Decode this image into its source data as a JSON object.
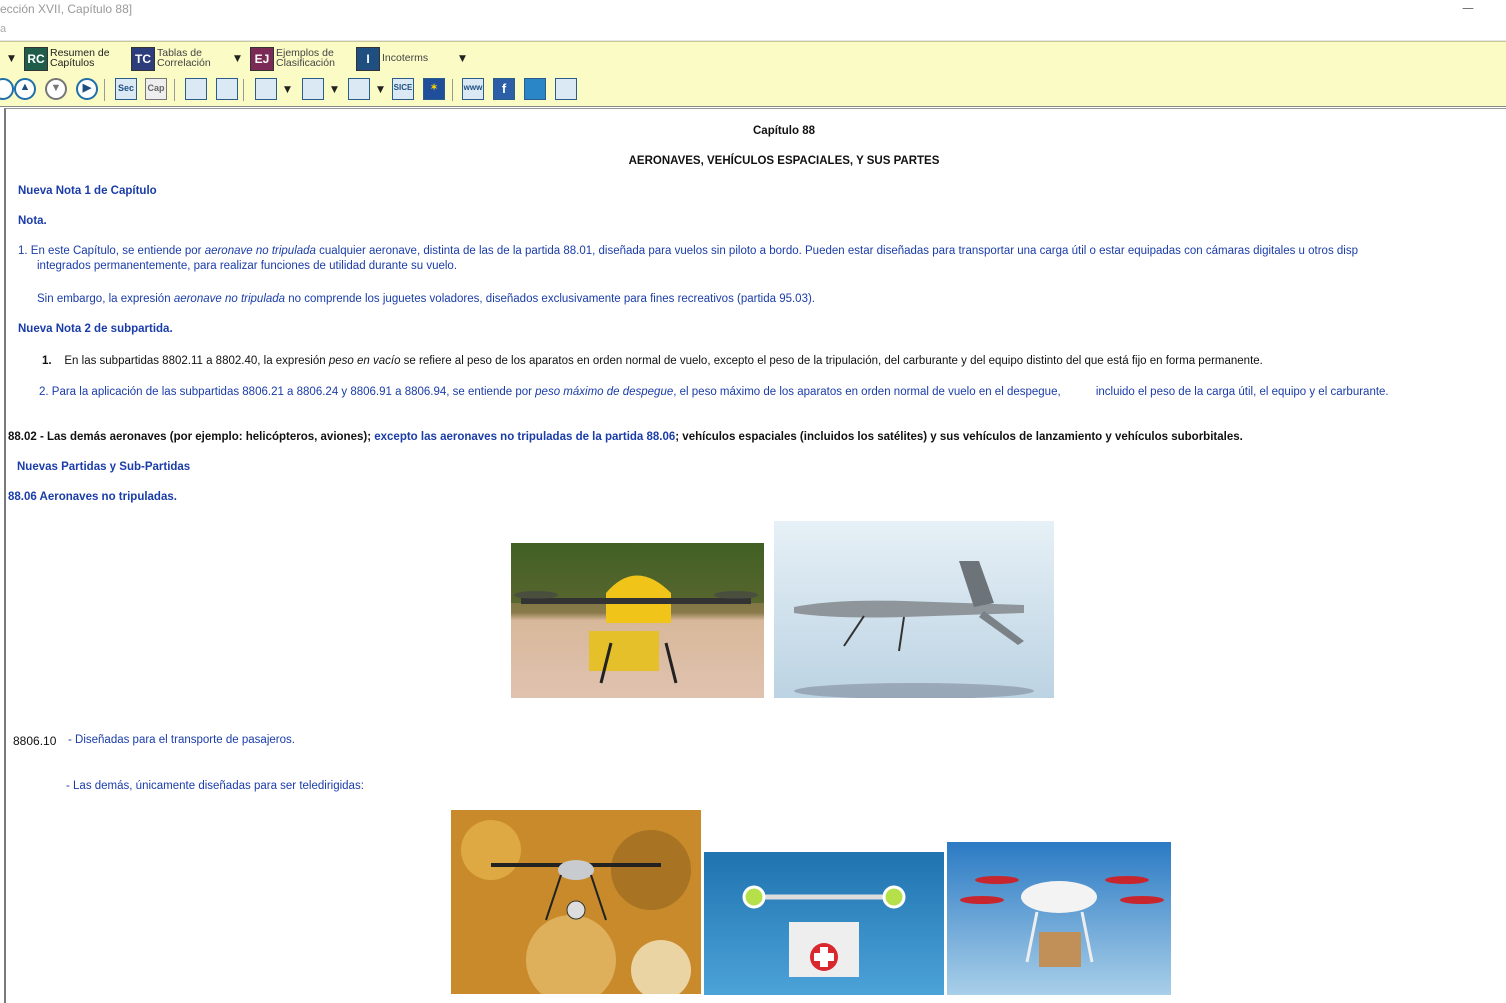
{
  "window": {
    "title": "ección XVII, Capítulo 88]",
    "menu_fragment": "a"
  },
  "toolbar": {
    "resumen": {
      "badge": "RC",
      "label": "Resumen de Capítulos",
      "color": "#1f5d4a"
    },
    "tablas": {
      "badge": "TC",
      "label": "Tablas de Correlación",
      "color": "#2d3c7a"
    },
    "ejemplos": {
      "badge": "EJ",
      "label": "Ejemplos de Clasificación",
      "color": "#7a2a55"
    },
    "incoterms": {
      "badge": "I",
      "label": "Incoterms",
      "color": "#1f4f80"
    },
    "sec_label": "Sec",
    "cap_label": "Cap",
    "sice_label": "SICE",
    "www_label": "www",
    "fb_label": "f"
  },
  "doc": {
    "chapter": "Capítulo 88",
    "chapter_title": "AERONAVES, VEHÍCULOS ESPACIALES, Y SUS PARTES",
    "nota1_heading": "Nueva Nota 1 de Capítulo",
    "nota_heading": "Nota.",
    "nota1_line1_a": "1. En este Capítulo, se entiende por ",
    "nota1_line1_i": "aeronave no tripulada",
    "nota1_line1_b": " cualquier aeronave, distinta de las de la partida 88.01, diseñada para vuelos sin piloto a bordo. Pueden estar diseñadas para transportar una carga útil o estar equipadas con cámaras digitales u otros disp",
    "nota1_line2": "integrados permanentemente, para realizar funciones de utilidad durante su vuelo.",
    "nota1_para2_a": "Sin embargo, la expresión ",
    "nota1_para2_i": "aeronave no tripulada",
    "nota1_para2_b": " no comprende los juguetes voladores, diseñados exclusivamente para fines recreativos (partida 95.03).",
    "nota2_heading": "Nueva Nota 2 de subpartida.",
    "sub1_num": "1.",
    "sub1_a": "En las subpartidas 8802.11 a 8802.40, la expresión ",
    "sub1_i": "peso en vacío",
    "sub1_b": " se refiere al peso de los aparatos en orden normal de vuelo, excepto el peso de la tripulación, del carburante y del equipo distinto del que está fijo en forma permanente.",
    "sub2_a": "2. Para la aplicación de las subpartidas 8806.21 a 8806.24 y 8806.91 a 8806.94, se entiende por ",
    "sub2_i": "peso máximo de despegue",
    "sub2_b": ", el peso máximo de los aparatos en orden normal de vuelo en el despegue,",
    "sub2_c": "incluido el peso de la carga útil, el equipo y el carburante.",
    "p8802_a": "88.02  -  Las demás aeronaves (por ejemplo: helicópteros, aviones);",
    "p8802_b": "excepto las aeronaves no tripuladas de la partida 88.06",
    "p8802_c": "; vehículos espaciales (incluidos los satélites) y sus vehículos de    lanzamiento y vehículos suborbitales.",
    "nuevas_partidas": "Nuevas Partidas y Sub-Partidas",
    "p8806": "88.06 Aeronaves no tripuladas.",
    "s880610_code": "8806.10",
    "s880610_text": "- Diseñadas para el transporte de pasajeros.",
    "las_demas": "-   Las demás, únicamente diseñadas para ser teledirigidas:"
  }
}
